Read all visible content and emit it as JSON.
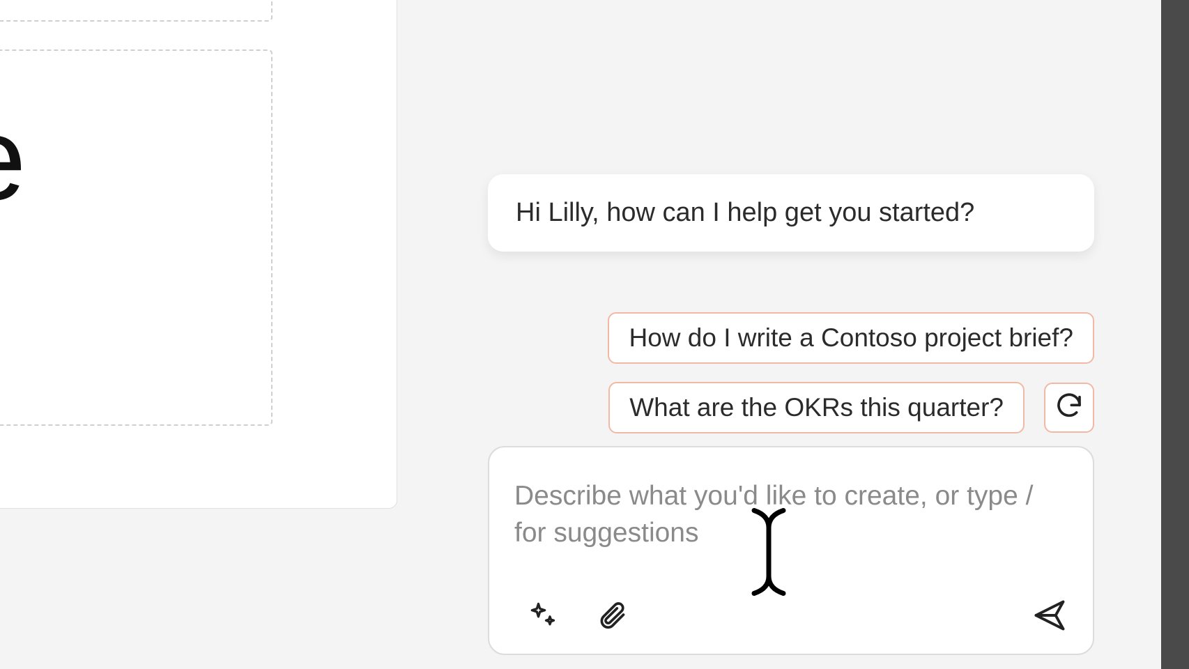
{
  "chat": {
    "greeting": "Hi Lilly, how can I help get you started?",
    "suggestions": [
      "How do I write a Contoso project brief?",
      "What are the OKRs this quarter?"
    ],
    "input_placeholder": "Describe what you'd like to create, or type / for suggestions"
  },
  "left_pane": {
    "partial_letter": "e"
  },
  "icons": {
    "refresh": "refresh-icon",
    "sparkle": "sparkle-icon",
    "attach": "paperclip-icon",
    "send": "send-icon"
  },
  "colors": {
    "suggestion_border": "#f2b8a5",
    "panel_bg": "#f4f4f4",
    "bubble_bg": "#ffffff"
  }
}
